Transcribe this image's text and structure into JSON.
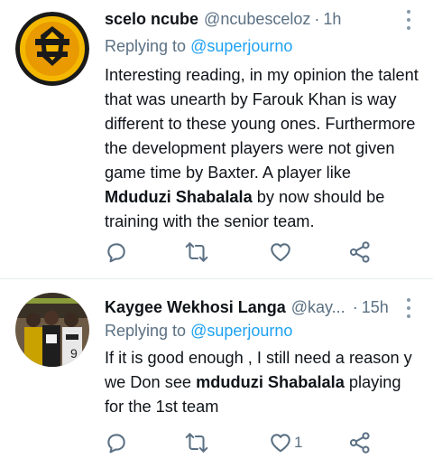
{
  "tweets": [
    {
      "name": "scelo ncube",
      "handle": "@ncubesceloz",
      "time": "1h",
      "replying_label": "Replying to",
      "replying_to": "@superjourno",
      "avatar": "kaizer-chiefs-logo",
      "body_parts": [
        "Interesting reading, in my opinion the talent that was unearth by Farouk Khan is way different to these young ones. Furthermore the development players were not given game time by Baxter. A player like ",
        "Mduduzi Shabalala",
        " by now should be training with the senior team."
      ],
      "like_count": ""
    },
    {
      "name": "Kaygee Wekhosi Langa",
      "handle": "@kay...",
      "time": "15h",
      "replying_label": "Replying to",
      "replying_to": "@superjourno",
      "avatar": "team-photo",
      "body_parts": [
        "If it is good enough , I still need a reason y we Don  see ",
        "mduduzi Shabalala",
        " playing for the 1st team"
      ],
      "like_count": "1"
    }
  ],
  "colors": {
    "text": "#0f1419",
    "muted": "#5b7083",
    "link": "#1da1f2",
    "icon": "#5b7083",
    "divider": "#e6ecf0"
  },
  "icons": [
    "reply-icon",
    "retweet-icon",
    "like-icon",
    "share-icon",
    "more-icon"
  ]
}
